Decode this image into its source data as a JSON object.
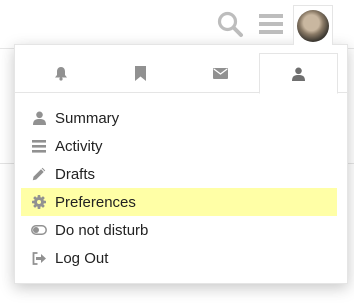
{
  "colors": {
    "icon_gray": "#919191",
    "text": "#222222",
    "highlight": "#ffffa6",
    "border": "#e5e5e5"
  },
  "header": {
    "icons": [
      "search-icon",
      "hamburger-icon",
      "user-avatar"
    ]
  },
  "tabs": [
    {
      "icon": "bell-icon",
      "active": false
    },
    {
      "icon": "bookmark-icon",
      "active": false
    },
    {
      "icon": "envelope-icon",
      "active": false
    },
    {
      "icon": "user-icon",
      "active": true
    }
  ],
  "menu": {
    "items": [
      {
        "label": "Summary",
        "icon": "user-icon"
      },
      {
        "label": "Activity",
        "icon": "list-icon"
      },
      {
        "label": "Drafts",
        "icon": "pencil-icon"
      },
      {
        "label": "Preferences",
        "icon": "gear-icon",
        "highlighted": true
      },
      {
        "label": "Do not disturb",
        "icon": "toggle-off-icon"
      },
      {
        "label": "Log Out",
        "icon": "sign-out-icon"
      }
    ]
  }
}
